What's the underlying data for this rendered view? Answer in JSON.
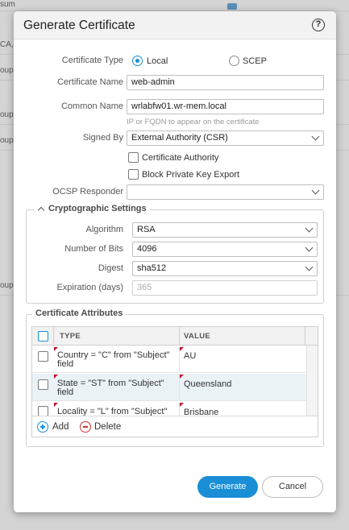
{
  "background": {
    "row_texts": [
      "sum",
      "CA,",
      "oup,",
      "oup,",
      "oup,",
      "oup,"
    ]
  },
  "dialog": {
    "title": "Generate Certificate",
    "help_icon": "question-circle-icon"
  },
  "form": {
    "certificate_type": {
      "label": "Certificate Type",
      "options": [
        "Local",
        "SCEP"
      ],
      "selected": "Local"
    },
    "certificate_name": {
      "label": "Certificate Name",
      "value": "web-admin"
    },
    "common_name": {
      "label": "Common Name",
      "value": "wrlabfw01.wr-mem.local",
      "hint": "IP or FQDN to appear on the certificate"
    },
    "signed_by": {
      "label": "Signed By",
      "value": "External Authority (CSR)"
    },
    "certificate_authority": {
      "label": "Certificate Authority",
      "checked": false
    },
    "block_private_key_export": {
      "label": "Block Private Key Export",
      "checked": false
    },
    "ocsp_responder": {
      "label": "OCSP Responder",
      "value": ""
    }
  },
  "crypto": {
    "legend": "Cryptographic Settings",
    "algorithm": {
      "label": "Algorithm",
      "value": "RSA"
    },
    "number_of_bits": {
      "label": "Number of Bits",
      "value": "4096"
    },
    "digest": {
      "label": "Digest",
      "value": "sha512"
    },
    "expiration": {
      "label": "Expiration (days)",
      "value": "365"
    }
  },
  "attributes": {
    "legend": "Certificate Attributes",
    "columns": [
      "TYPE",
      "VALUE"
    ],
    "rows": [
      {
        "type_line1": "Country = \"C\" from \"Subject\"",
        "type_line2": "field",
        "value": "AU"
      },
      {
        "type_line1": "State = \"ST\" from \"Subject\"",
        "type_line2": "field",
        "value": "Queensland"
      },
      {
        "type_line1": "Locality = \"L\" from \"Subject\"",
        "type_line2": "",
        "value": "Brisbane"
      }
    ],
    "add_label": "Add",
    "delete_label": "Delete"
  },
  "buttons": {
    "generate": "Generate",
    "cancel": "Cancel"
  },
  "colors": {
    "accent": "#1a8fd6",
    "danger": "#d0312d",
    "required_marker": "#c8102e"
  }
}
